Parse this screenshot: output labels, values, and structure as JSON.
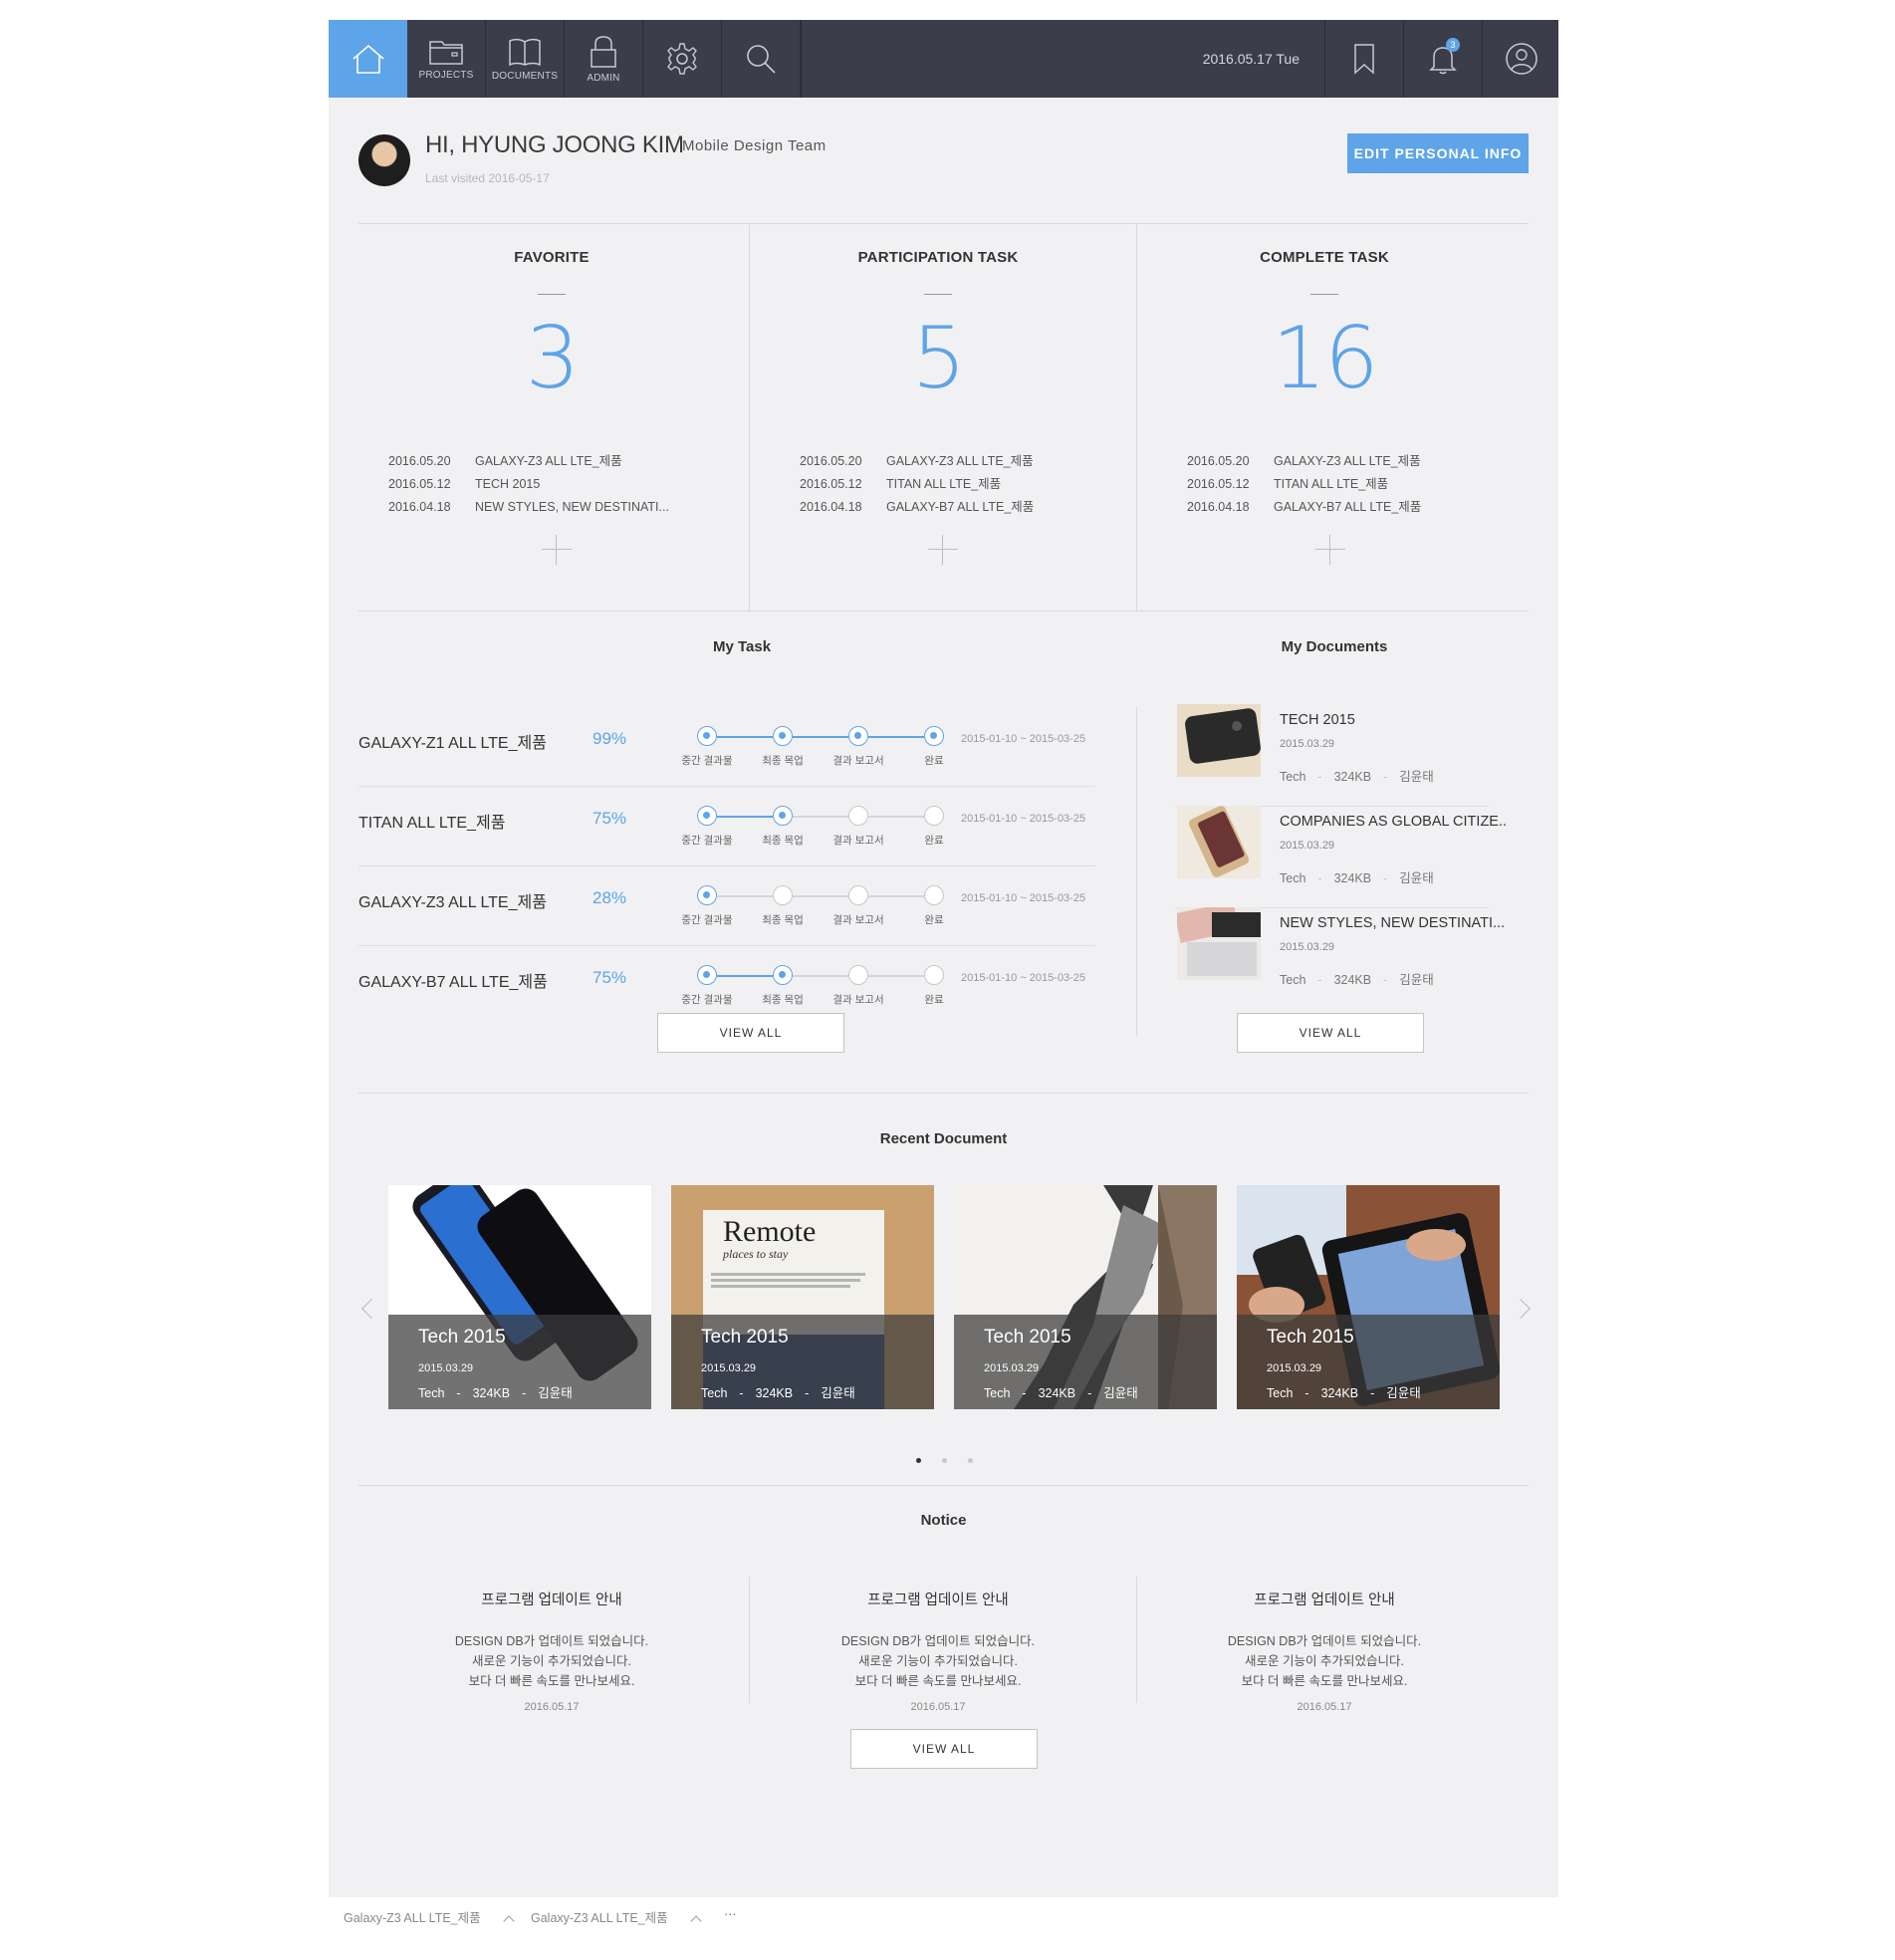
{
  "nav": {
    "items": [
      {
        "label": "",
        "icon": "home-icon"
      },
      {
        "label": "PROJECTS",
        "icon": "folder-icon"
      },
      {
        "label": "DOCUMENTS",
        "icon": "book-icon"
      },
      {
        "label": "ADMIN",
        "icon": "lock-icon"
      },
      {
        "label": "",
        "icon": "gear-icon"
      },
      {
        "label": "",
        "icon": "search-icon"
      }
    ],
    "date": "2016.05.17 Tue",
    "notification_count": "3",
    "accent": "#5ea4e8",
    "bar_color": "#3c3d4a"
  },
  "profile": {
    "greeting": "HI, HYUNG JOONG KIM",
    "team": "Mobile Design Team",
    "last_visited": "Last visited 2016-05-17",
    "edit_button": "EDIT PERSONAL INFO"
  },
  "stats": [
    {
      "title": "FAVORITE",
      "count": "3",
      "rows": [
        {
          "date": "2016.05.20",
          "name": "GALAXY-Z3 ALL LTE_제품"
        },
        {
          "date": "2016.05.12",
          "name": "TECH 2015"
        },
        {
          "date": "2016.04.18",
          "name": "NEW STYLES, NEW DESTINATI..."
        }
      ]
    },
    {
      "title": "PARTICIPATION TASK",
      "count": "5",
      "rows": [
        {
          "date": "2016.05.20",
          "name": "GALAXY-Z3 ALL LTE_제품"
        },
        {
          "date": "2016.05.12",
          "name": "TITAN ALL LTE_제품"
        },
        {
          "date": "2016.04.18",
          "name": "GALAXY-B7 ALL LTE_제품"
        }
      ]
    },
    {
      "title": "COMPLETE TASK",
      "count": "16",
      "rows": [
        {
          "date": "2016.05.20",
          "name": "GALAXY-Z3 ALL LTE_제품"
        },
        {
          "date": "2016.05.12",
          "name": "TITAN ALL LTE_제품"
        },
        {
          "date": "2016.04.18",
          "name": "GALAXY-B7 ALL LTE_제품"
        }
      ]
    }
  ],
  "my_task": {
    "title": "My Task",
    "step_labels": [
      "중간 결과물",
      "최종 목업",
      "결과 보고서",
      "완료"
    ],
    "tasks": [
      {
        "name": "GALAXY-Z1 ALL LTE_제품",
        "percent": "99%",
        "steps_done": 4,
        "period": "2015-01-10 ~ 2015-03-25"
      },
      {
        "name": "TITAN ALL LTE_제품",
        "percent": "75%",
        "steps_done": 2,
        "period": "2015-01-10 ~ 2015-03-25"
      },
      {
        "name": "GALAXY-Z3 ALL LTE_제품",
        "percent": "28%",
        "steps_done": 1,
        "period": "2015-01-10 ~ 2015-03-25"
      },
      {
        "name": "GALAXY-B7 ALL LTE_제품",
        "percent": "75%",
        "steps_done": 2,
        "period": "2015-01-10 ~ 2015-03-25"
      }
    ],
    "view_all": "VIEW ALL"
  },
  "my_documents": {
    "title": "My Documents",
    "items": [
      {
        "title": "TECH 2015",
        "date": "2015.03.29",
        "category": "Tech",
        "size": "324KB",
        "author": "김윤태"
      },
      {
        "title": "COMPANIES AS GLOBAL CITIZE..",
        "date": "2015.03.29",
        "category": "Tech",
        "size": "324KB",
        "author": "김윤태"
      },
      {
        "title": "NEW STYLES, NEW DESTINATI...",
        "date": "2015.03.29",
        "category": "Tech",
        "size": "324KB",
        "author": "김윤태"
      }
    ],
    "separator": "-",
    "view_all": "VIEW ALL"
  },
  "recent": {
    "title": "Recent Document",
    "book_title": "Remote",
    "book_subtitle": "places to stay",
    "cards": [
      {
        "title": "Tech 2015",
        "date": "2015.03.29",
        "category": "Tech",
        "size": "324KB",
        "author": "김윤태"
      },
      {
        "title": "Tech 2015",
        "date": "2015.03.29",
        "category": "Tech",
        "size": "324KB",
        "author": "김윤태"
      },
      {
        "title": "Tech 2015",
        "date": "2015.03.29",
        "category": "Tech",
        "size": "324KB",
        "author": "김윤태"
      },
      {
        "title": "Tech 2015",
        "date": "2015.03.29",
        "category": "Tech",
        "size": "324KB",
        "author": "김윤태"
      }
    ],
    "separator": "-",
    "page_count": 3,
    "active_page": 1
  },
  "notice": {
    "title": "Notice",
    "items": [
      {
        "title": "프로그램 업데이트 안내",
        "line1": "DESIGN DB가 업데이트 되었습니다.",
        "line2": "새로운 기능이 추가되었습니다.",
        "line3": "보다 더 빠른 속도를 만나보세요.",
        "date": "2016.05.17"
      },
      {
        "title": "프로그램 업데이트 안내",
        "line1": "DESIGN DB가 업데이트 되었습니다.",
        "line2": "새로운 기능이 추가되었습니다.",
        "line3": "보다 더 빠른 속도를 만나보세요.",
        "date": "2016.05.17"
      },
      {
        "title": "프로그램 업데이트 안내",
        "line1": "DESIGN DB가 업데이트 되었습니다.",
        "line2": "새로운 기능이 추가되었습니다.",
        "line3": "보다 더 빠른 속도를 만나보세요.",
        "date": "2016.05.17"
      }
    ],
    "view_all": "VIEW ALL"
  },
  "footer_tabs": {
    "items": [
      "Galaxy-Z3 ALL LTE_제품",
      "Galaxy-Z3 ALL LTE_제품"
    ],
    "more": "···"
  }
}
